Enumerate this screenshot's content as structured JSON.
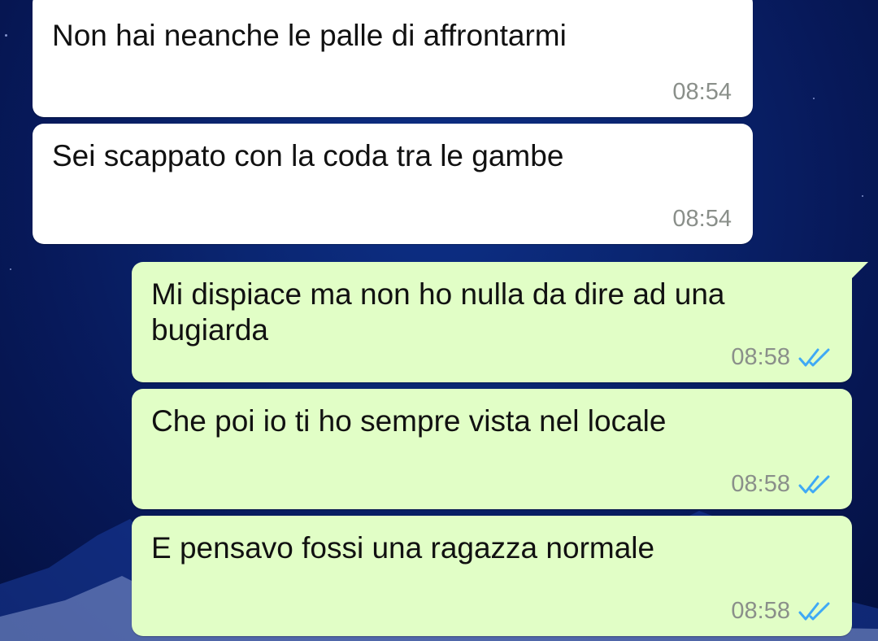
{
  "colors": {
    "incoming_bubble": "#ffffff",
    "outgoing_bubble": "#e1fec6",
    "timestamp": "#8a8f8a",
    "read_ticks": "#3fa9f5",
    "wallpaper": "#0a2570"
  },
  "messages": [
    {
      "direction": "incoming",
      "text": "Non hai neanche le palle di affrontarmi",
      "time": "08:54"
    },
    {
      "direction": "incoming",
      "text": "Sei scappato con la coda tra le gambe",
      "time": "08:54"
    },
    {
      "direction": "outgoing",
      "text": "Mi dispiace ma non ho nulla da dire ad una\nbugiarda",
      "time": "08:58",
      "status_icon": "double-check-read-icon"
    },
    {
      "direction": "outgoing",
      "text": "Che poi io ti ho sempre vista nel locale",
      "time": "08:58",
      "status_icon": "double-check-read-icon"
    },
    {
      "direction": "outgoing",
      "text": "E pensavo fossi una ragazza normale",
      "time": "08:58",
      "status_icon": "double-check-read-icon"
    }
  ]
}
